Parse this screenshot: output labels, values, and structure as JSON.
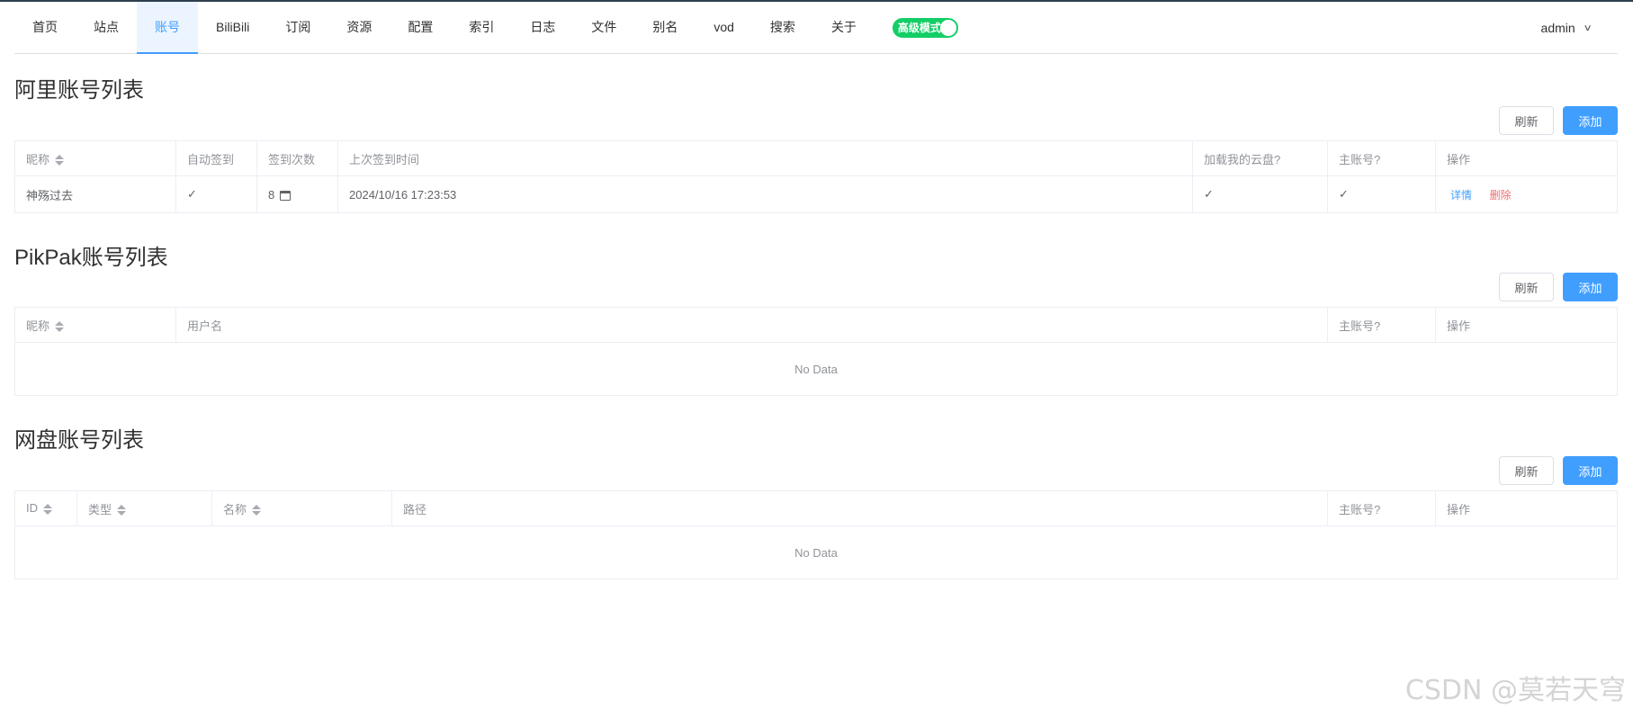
{
  "nav": {
    "items": [
      "首页",
      "站点",
      "账号",
      "BiliBili",
      "订阅",
      "资源",
      "配置",
      "索引",
      "日志",
      "文件",
      "别名",
      "vod",
      "搜索",
      "关于"
    ],
    "active": "账号",
    "switch_label": "高级模式",
    "switch_on": true,
    "user": "admin"
  },
  "buttons": {
    "refresh": "刷新",
    "add": "添加"
  },
  "ali": {
    "title": "阿里账号列表",
    "columns": [
      "昵称",
      "自动签到",
      "签到次数",
      "上次签到时间",
      "加载我的云盘?",
      "主账号?",
      "操作"
    ],
    "rows": [
      {
        "nickname": "神殇过去",
        "auto_sign": "✓",
        "sign_count": "8",
        "last_sign_time": "2024/10/16 17:23:53",
        "load_drive": "✓",
        "main": "✓",
        "detail": "详情",
        "delete": "删除"
      }
    ]
  },
  "pikpak": {
    "title": "PikPak账号列表",
    "columns": [
      "昵称",
      "用户名",
      "主账号?",
      "操作"
    ],
    "empty": "No Data"
  },
  "netdisk": {
    "title": "网盘账号列表",
    "columns": [
      "ID",
      "类型",
      "名称",
      "路径",
      "主账号?",
      "操作"
    ],
    "empty": "No Data"
  },
  "watermark": "CSDN @莫若天穹",
  "colors": {
    "primary": "#409eff",
    "danger": "#f56c6c",
    "switch": "#13ce66"
  }
}
